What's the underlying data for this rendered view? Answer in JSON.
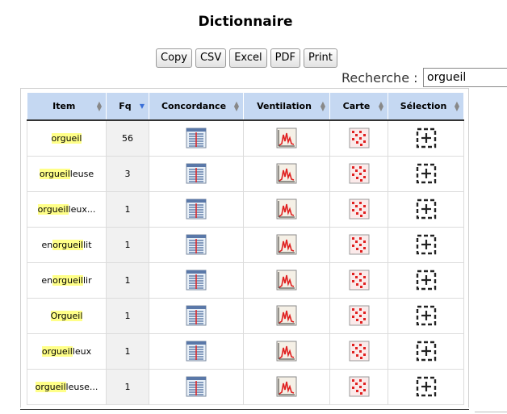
{
  "page_title": "Dictionnaire",
  "buttons": [
    "Copy",
    "CSV",
    "Excel",
    "PDF",
    "Print"
  ],
  "search": {
    "label": "Recherche :",
    "value": "orgueil"
  },
  "table": {
    "columns": [
      "Item",
      "Fq",
      "Concordance",
      "Ventilation",
      "Carte",
      "Sélection"
    ],
    "sorted_column": "Fq",
    "sort_direction": "descending",
    "highlight_color": "#ffff88",
    "row_icons": [
      "concordance-icon",
      "ventilation-icon",
      "carte-icon",
      "selection-icon"
    ],
    "rows": [
      {
        "pre": "",
        "hl": "orgueil",
        "post": "",
        "fq": "56"
      },
      {
        "pre": "",
        "hl": "orgueil",
        "post": "leuse",
        "fq": "3"
      },
      {
        "pre": "",
        "hl": "orgueil",
        "post": "leux...",
        "fq": "1"
      },
      {
        "pre": "en",
        "hl": "orgueil",
        "post": "lit",
        "fq": "1"
      },
      {
        "pre": "en",
        "hl": "orgueil",
        "post": "lir",
        "fq": "1"
      },
      {
        "pre": "",
        "hl": "Orgueil",
        "post": "",
        "fq": "1"
      },
      {
        "pre": "",
        "hl": "orgueil",
        "post": "leux",
        "fq": "1"
      },
      {
        "pre": "",
        "hl": "orgueil",
        "post": "leuse...",
        "fq": "1"
      }
    ]
  }
}
